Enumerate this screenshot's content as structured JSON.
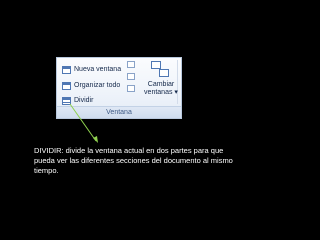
{
  "ribbon": {
    "items": [
      {
        "label": "Nueva ventana",
        "icon": "new-window-icon"
      },
      {
        "label": "Organizar todo",
        "icon": "arrange-all-icon"
      },
      {
        "label": "Dividir",
        "icon": "split-window-icon"
      }
    ],
    "switch_windows": {
      "line1": "Cambiar",
      "line2": "ventanas",
      "arrow": "▾",
      "icon": "switch-windows-icon"
    },
    "group_label": "Ventana"
  },
  "caption": "DIVIDIR: divide la ventana actual en dos partes para que pueda ver las diferentes secciones del documento al mismo tiempo.",
  "colors": {
    "background": "#000000",
    "caption_text": "#ffffff",
    "arrow": "#8fd14f"
  }
}
